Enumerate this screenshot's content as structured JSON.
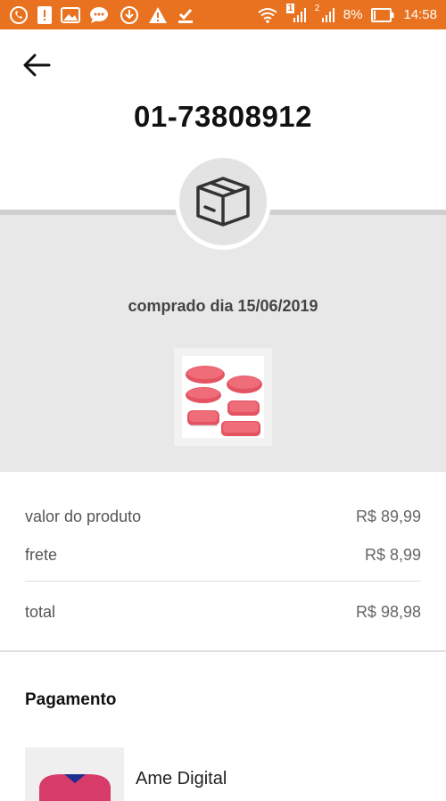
{
  "status_bar": {
    "battery_percent": "8%",
    "time": "14:58",
    "sim1": "1",
    "sim2": "2",
    "background_color": "#e8721f"
  },
  "header": {
    "back_icon": "arrow-left-icon",
    "order_number": "01-73808912"
  },
  "order": {
    "status_icon": "package-box-icon",
    "purchase_date_text": "comprado dia 15/06/2019",
    "product_image": "food-containers-red-lids"
  },
  "prices": {
    "product_value_label": "valor do produto",
    "product_value": "R$ 89,99",
    "shipping_label": "frete",
    "shipping_value": "R$ 8,99",
    "total_label": "total",
    "total_value": "R$ 98,98"
  },
  "payment": {
    "section_title": "Pagamento",
    "method_name": "Ame Digital",
    "method_logo": "ame-digital-logo"
  },
  "colors": {
    "accent_orange": "#e8721f",
    "band_gray": "#e8e8e8",
    "container_lid_red": "#e0525f"
  }
}
